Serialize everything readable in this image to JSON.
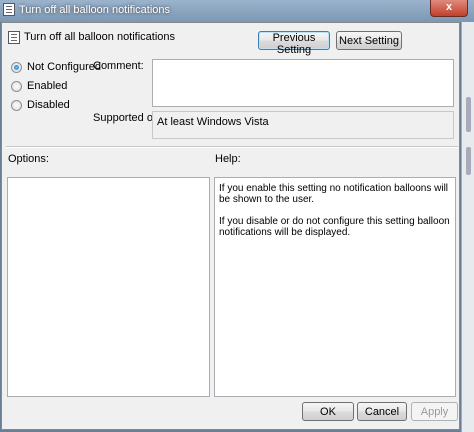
{
  "window": {
    "title": "Turn off all balloon notifications",
    "close_glyph": "x"
  },
  "header": {
    "title": "Turn off all balloon notifications",
    "icon": "policy-icon"
  },
  "nav": {
    "previous_label": "Previous Setting",
    "next_label": "Next Setting"
  },
  "options_radio": {
    "selected": "Not Configured",
    "items": [
      "Not Configured",
      "Enabled",
      "Disabled"
    ]
  },
  "comment": {
    "label": "Comment:",
    "value": ""
  },
  "supported": {
    "label": "Supported on:",
    "value": "At least Windows Vista"
  },
  "panels": {
    "options_label": "Options:",
    "help_label": "Help:",
    "help_paragraphs": [
      "If you enable this setting no notification balloons will be shown to the user.",
      "If you disable or do not configure this setting balloon notifications will be displayed."
    ]
  },
  "footer": {
    "ok_label": "OK",
    "cancel_label": "Cancel",
    "apply_label": "Apply"
  }
}
